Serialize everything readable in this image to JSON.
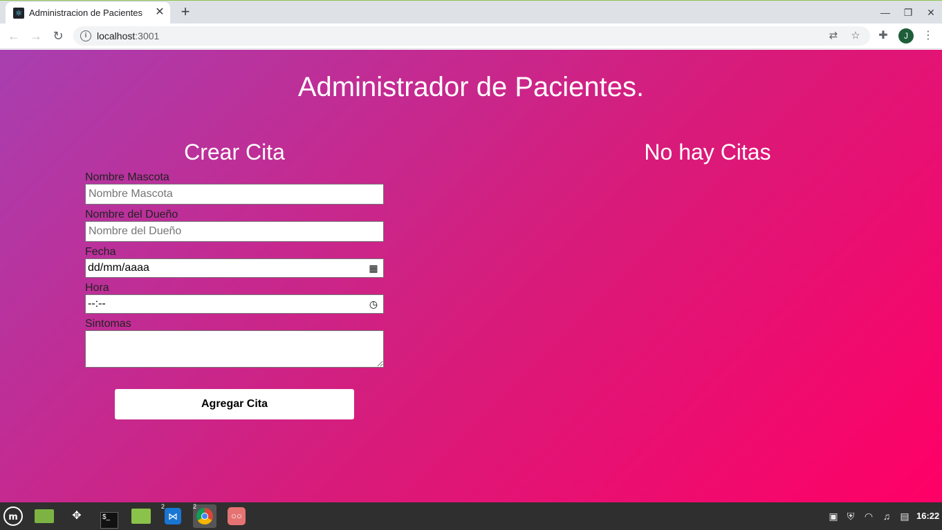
{
  "browser": {
    "tab_title": "Administracion de Pacientes",
    "url_host": "localhost",
    "url_port": ":3001",
    "profile_initial": "J",
    "icons": [
      "back-icon",
      "forward-icon",
      "reload-icon",
      "info-icon",
      "translate-icon",
      "star-icon",
      "extensions-icon",
      "menu-icon"
    ]
  },
  "page": {
    "title": "Administrador de Pacientes.",
    "form_heading": "Crear Cita",
    "list_heading": "No hay Citas",
    "fields": {
      "pet_label": "Nombre Mascota",
      "pet_placeholder": "Nombre Mascota",
      "owner_label": "Nombre del Dueño",
      "owner_placeholder": "Nombre del Dueño",
      "date_label": "Fecha",
      "date_value": "dd/mm/aaaa",
      "time_label": "Hora",
      "time_value": "--:--",
      "symptoms_label": "Sintomas"
    },
    "submit_label": "Agregar Cita",
    "gradient": [
      "#a83fb0",
      "#ff0066"
    ]
  },
  "taskbar": {
    "vscode_badge": "2",
    "chrome_badge": "2",
    "clock": "16:22"
  }
}
